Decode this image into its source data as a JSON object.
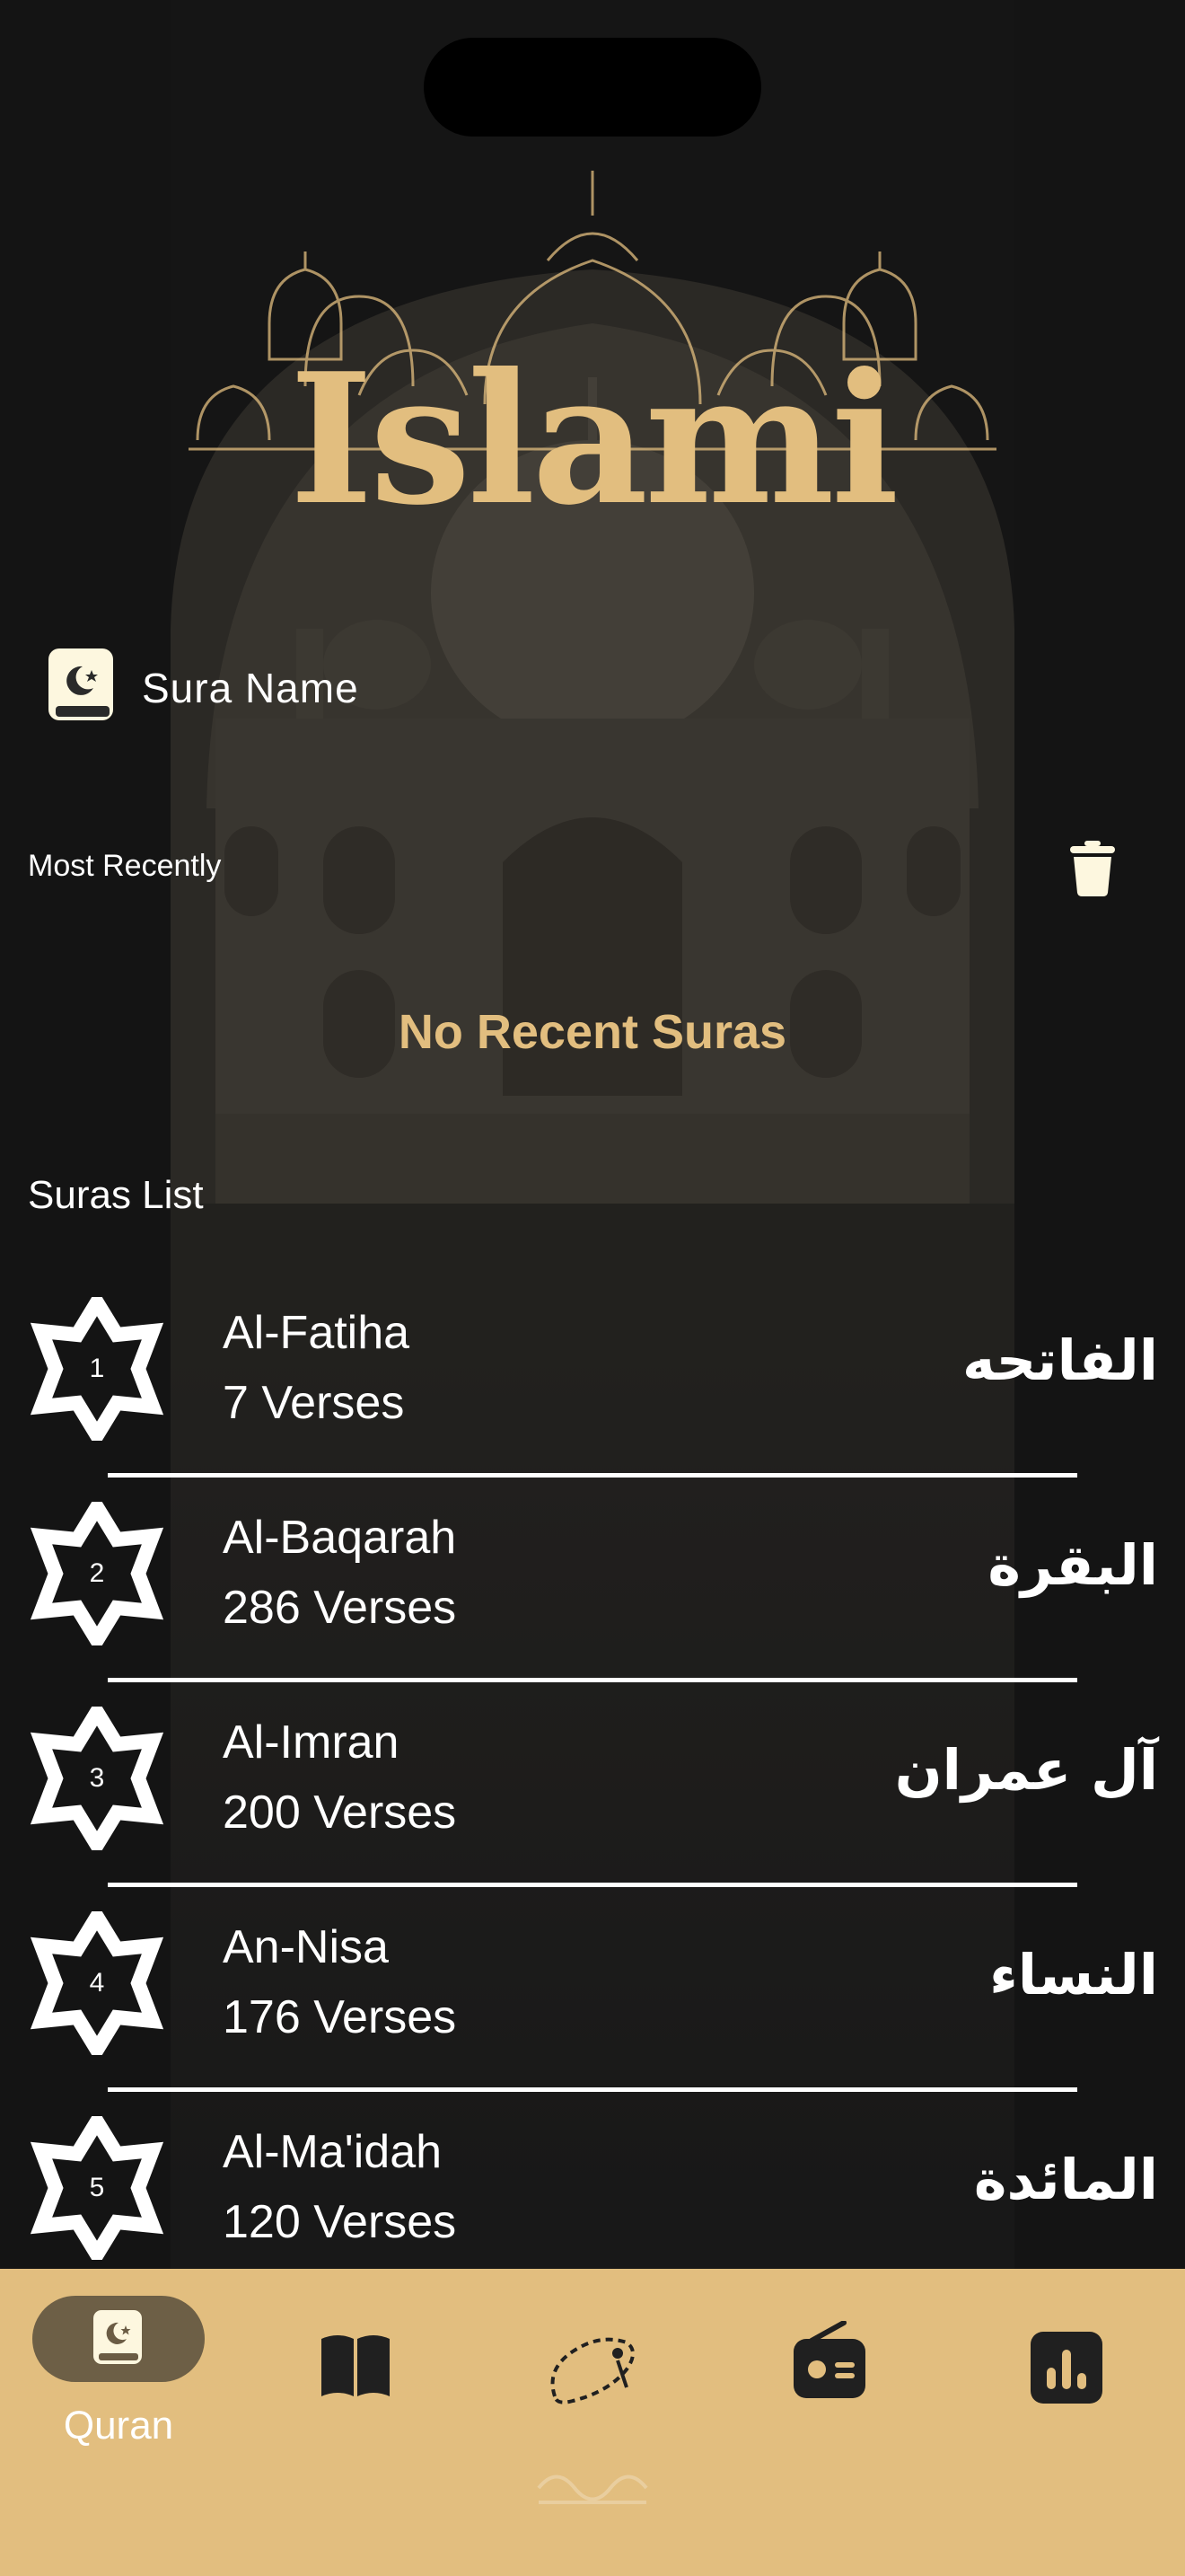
{
  "app": {
    "logo": "Islami"
  },
  "search": {
    "label": "Sura Name",
    "icon": "quran-book-icon"
  },
  "recent": {
    "title": "Most Recently",
    "empty_text": "No Recent Suras",
    "clear_icon": "trash-icon"
  },
  "suras": {
    "title": "Suras List",
    "items": [
      {
        "number": "1",
        "name": "Al-Fatiha",
        "verses": "7 Verses",
        "arabic": "الفاتحه"
      },
      {
        "number": "2",
        "name": "Al-Baqarah",
        "verses": "286 Verses",
        "arabic": "البقرة"
      },
      {
        "number": "3",
        "name": "Al-Imran",
        "verses": "200 Verses",
        "arabic": "آل عمران"
      },
      {
        "number": "4",
        "name": "An-Nisa",
        "verses": "176 Verses",
        "arabic": "النساء"
      },
      {
        "number": "5",
        "name": "Al-Ma'idah",
        "verses": "120 Verses",
        "arabic": "المائدة"
      }
    ]
  },
  "nav": {
    "items": [
      {
        "label": "Quran",
        "icon": "quran-icon",
        "active": true
      },
      {
        "label": "",
        "icon": "hadith-book-icon",
        "active": false
      },
      {
        "label": "",
        "icon": "sebha-icon",
        "active": false
      },
      {
        "label": "",
        "icon": "radio-icon",
        "active": false
      },
      {
        "label": "",
        "icon": "time-chart-icon",
        "active": false
      }
    ]
  },
  "colors": {
    "accent": "#E2BE7F",
    "background": "#202020",
    "text": "#FFFFFF"
  }
}
